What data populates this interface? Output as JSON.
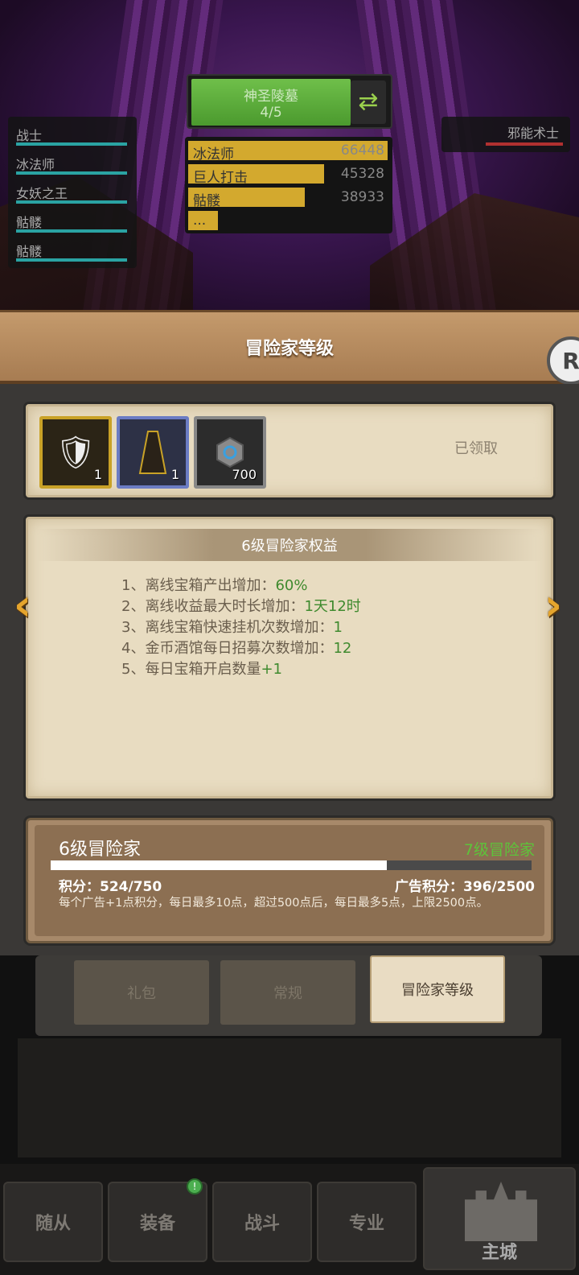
{
  "battle": {
    "stage": {
      "name": "神圣陵墓",
      "progress": "4/5"
    },
    "team_left": [
      "战士",
      "冰法师",
      "女妖之王",
      "骷髅",
      "骷髅"
    ],
    "team_right": [
      "邪能术士"
    ],
    "damage": [
      {
        "name": "冰法师",
        "value": "66448",
        "ratio": 1.0
      },
      {
        "name": "巨人打击",
        "value": "45328",
        "ratio": 0.682
      },
      {
        "name": "骷髅",
        "value": "38933",
        "ratio": 0.586
      },
      {
        "name": "...",
        "value": "",
        "ratio": 0.15
      }
    ]
  },
  "dialog": {
    "title": "冒险家等级",
    "rewards": [
      {
        "count": "1",
        "icon": "gold-armor-icon"
      },
      {
        "count": "1",
        "icon": "cloak-icon"
      },
      {
        "count": "700",
        "icon": "gem-icon"
      }
    ],
    "claimed_label": "已领取",
    "benefits": {
      "title": "6级冒险家权益",
      "items": [
        {
          "text": "1、离线宝箱产出增加：",
          "value": "60%"
        },
        {
          "text": "2、离线收益最大时长增加：",
          "value": "1天12时"
        },
        {
          "text": "3、离线宝箱快速挂机次数增加：",
          "value": "1"
        },
        {
          "text": "4、金币酒馆每日招募次数增加：",
          "value": "12"
        },
        {
          "text": "5、每日宝箱开启数量",
          "value": "+1"
        }
      ]
    },
    "level": {
      "current": "6级冒险家",
      "next": "7级冒险家",
      "points_label": "积分：524/750",
      "points_ratio": 0.6987,
      "ad_points_label": "广告积分：396/2500",
      "note": "每个广告+1点积分，每日最多10点，超过500点后，每日最多5点，上限2500点。"
    }
  },
  "tabs": [
    "礼包",
    "常规",
    "冒险家等级"
  ],
  "bottom_nav": [
    "随从",
    "装备",
    "战斗",
    "专业",
    "主城"
  ],
  "colors": {
    "accent_green": "#3f8a2e",
    "next_level_green": "#5dc43a",
    "gold": "#d3a92e"
  }
}
